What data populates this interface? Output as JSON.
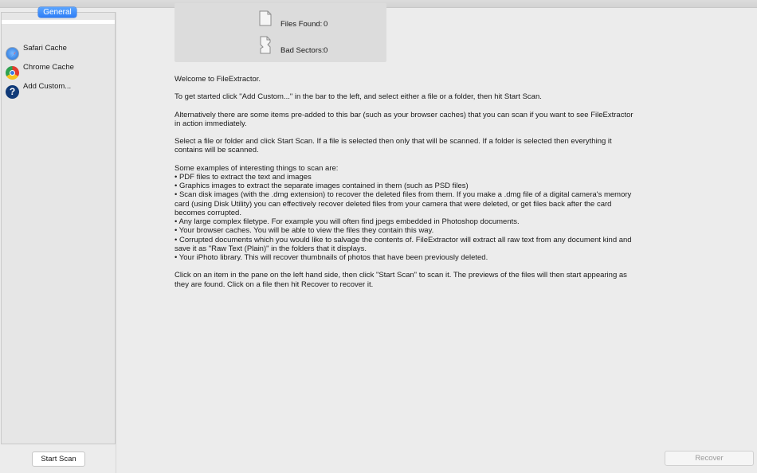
{
  "sidebar": {
    "segment": "General",
    "items": [
      {
        "label": "Safari Cache",
        "icon": "safari-icon"
      },
      {
        "label": "Chrome Cache",
        "icon": "chrome-icon"
      },
      {
        "label": "Add Custom...",
        "icon": "question-mark-icon"
      }
    ],
    "start_scan": "Start Scan"
  },
  "stats": {
    "files_found_label": "Files Found:",
    "files_found_value": "0",
    "bad_sectors_label": "Bad Sectors:",
    "bad_sectors_value": "0"
  },
  "content": {
    "p1": "Welcome to FileExtractor.",
    "p2": "To get started click \"Add Custom...\" in the bar to the left, and select either a file or a folder, then hit Start Scan.",
    "p3": "Alternatively there are some items pre-added to this bar (such as your browser caches) that you can scan if you want to see FileExtractor in action immediately.",
    "p4": "Select a file or folder and click Start Scan. If a file is selected then only that will be scanned. If a folder is selected then everything it contains will be scanned.",
    "examples_intro": "Some examples of interesting things to scan are:",
    "examples": [
      "• PDF files to extract the text and images",
      "• Graphics images to extract the separate images contained in them (such as PSD files)",
      "• Scan disk images (with the .dmg extension) to recover the deleted files from them. If you make a .dmg file of a digital camera's memory card (using Disk Utility) you can effectively recover deleted files from your camera that were deleted, or get files back after the card becomes corrupted.",
      "• Any large complex filetype. For example you will often find jpegs embedded in Photoshop documents.",
      "• Your browser caches. You will be able to view the files they contain this way.",
      "• Corrupted documents which you would like to salvage the contents of. FileExtractor will extract all raw text from any document kind and save it as \"Raw Text (Plain)\" in the folders that it displays.",
      "• Your iPhoto library. This will recover thumbnails of photos that have been previously deleted."
    ],
    "p_last": "Click on an item in the pane on the left hand side, then click \"Start Scan\" to scan it. The previews of the files will then start appearing as they are found. Click on a file then hit Recover to recover it."
  },
  "actions": {
    "recover": "Recover"
  }
}
